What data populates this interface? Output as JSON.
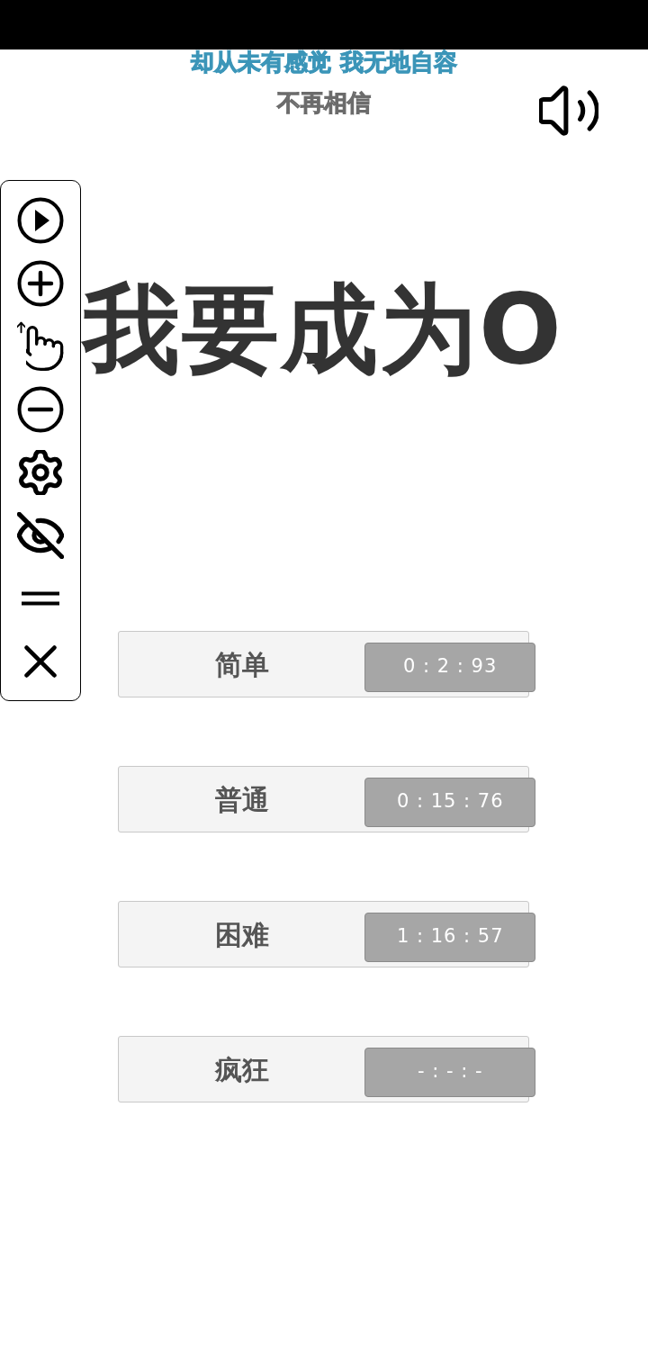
{
  "lyrics": [
    {
      "kind": "current",
      "text": "却从未有感觉 我无地自容"
    },
    {
      "kind": "next",
      "text": "不再相信"
    }
  ],
  "title": "我要成为O",
  "records": [
    {
      "label": "简单",
      "time": "0 : 2 : 93"
    },
    {
      "label": "普通",
      "time": "0 : 15 : 76"
    },
    {
      "label": "困难",
      "time": "1 : 16 : 57"
    },
    {
      "label": "疯狂",
      "time": "- : - : -"
    }
  ]
}
